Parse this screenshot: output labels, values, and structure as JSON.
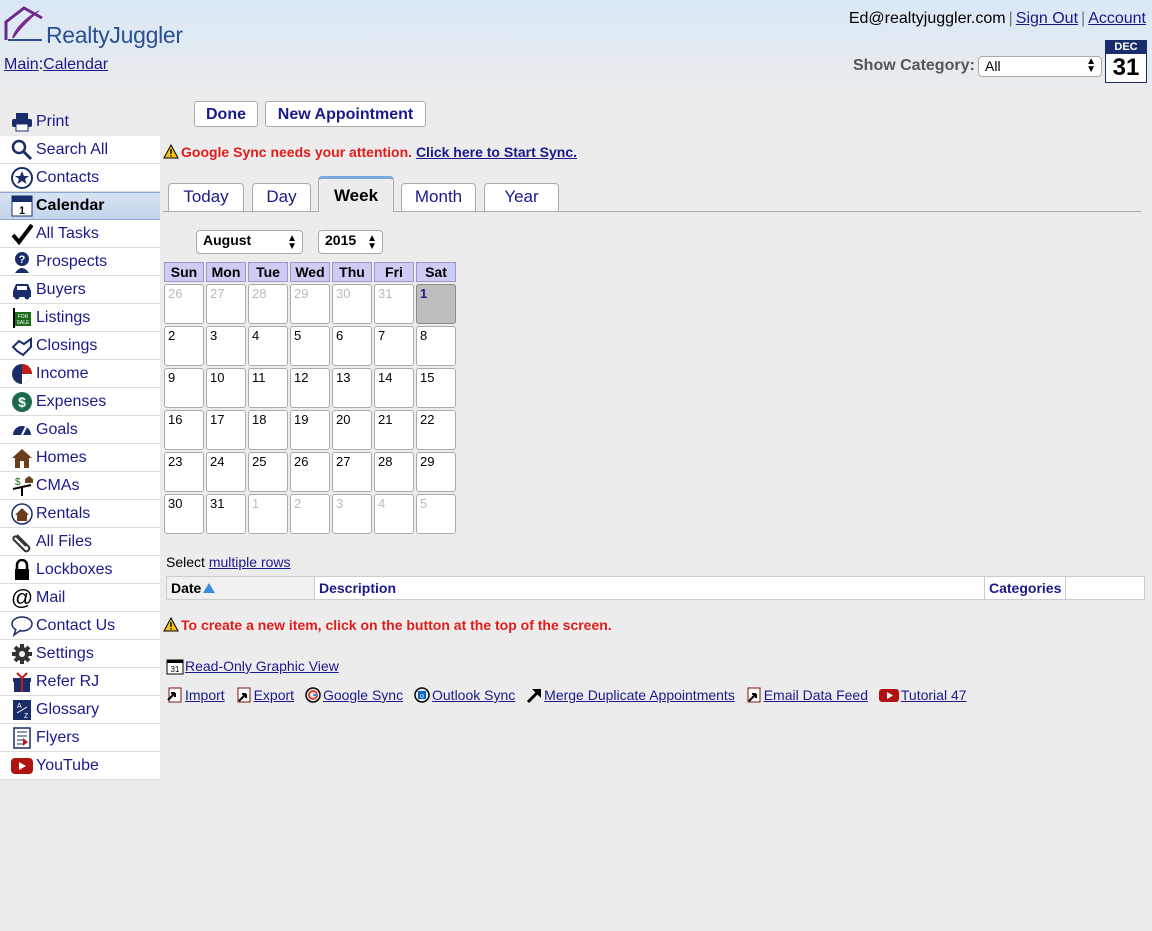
{
  "header": {
    "logo_text": "RealtyJuggler",
    "breadcrumb": {
      "main": "Main",
      "sep": ":",
      "current": "Calendar"
    },
    "user_email": "Ed@realtyjuggler.com",
    "sign_out": "Sign Out",
    "account": "Account",
    "show_category_label": "Show Category:",
    "category_value": "All",
    "cal_icon": {
      "month": "DEC",
      "day": "31"
    }
  },
  "sidebar": {
    "print": "Print",
    "items": [
      {
        "label": "Search All",
        "icon": "search-icon"
      },
      {
        "label": "Contacts",
        "icon": "star-icon"
      },
      {
        "label": "Calendar",
        "icon": "calendar-icon",
        "active": true
      },
      {
        "label": "All Tasks",
        "icon": "checkmark-icon"
      },
      {
        "label": "Prospects",
        "icon": "question-person-icon"
      },
      {
        "label": "Buyers",
        "icon": "car-icon"
      },
      {
        "label": "Listings",
        "icon": "for-sale-sign-icon"
      },
      {
        "label": "Closings",
        "icon": "handshake-icon"
      },
      {
        "label": "Income",
        "icon": "pie-chart-icon"
      },
      {
        "label": "Expenses",
        "icon": "dollar-icon"
      },
      {
        "label": "Goals",
        "icon": "gauge-icon"
      },
      {
        "label": "Homes",
        "icon": "house-icon"
      },
      {
        "label": "CMAs",
        "icon": "scale-icon"
      },
      {
        "label": "Rentals",
        "icon": "rental-house-icon"
      },
      {
        "label": "All Files",
        "icon": "paperclip-icon"
      },
      {
        "label": "Lockboxes",
        "icon": "lock-icon"
      },
      {
        "label": "Mail",
        "icon": "at-icon"
      },
      {
        "label": "Contact Us",
        "icon": "speech-bubble-icon"
      },
      {
        "label": "Settings",
        "icon": "gear-icon"
      },
      {
        "label": "Refer RJ",
        "icon": "gift-icon"
      },
      {
        "label": "Glossary",
        "icon": "glossary-icon"
      },
      {
        "label": "Flyers",
        "icon": "flyer-icon"
      },
      {
        "label": "YouTube",
        "icon": "youtube-icon"
      }
    ]
  },
  "toolbar": {
    "done": "Done",
    "new_appointment": "New Appointment"
  },
  "sync_warning": {
    "text": "Google Sync needs your attention.",
    "link": "Click here to Start Sync."
  },
  "tabs": [
    "Today",
    "Day",
    "Week",
    "Month",
    "Year"
  ],
  "active_tab": "Week",
  "calendar": {
    "month": "August",
    "year": "2015",
    "weekdays": [
      "Sun",
      "Mon",
      "Tue",
      "Wed",
      "Thu",
      "Fri",
      "Sat"
    ],
    "weeks": [
      [
        "26",
        "27",
        "28",
        "29",
        "30",
        "31",
        "1"
      ],
      [
        "2",
        "3",
        "4",
        "5",
        "6",
        "7",
        "8"
      ],
      [
        "9",
        "10",
        "11",
        "12",
        "13",
        "14",
        "15"
      ],
      [
        "16",
        "17",
        "18",
        "19",
        "20",
        "21",
        "22"
      ],
      [
        "23",
        "24",
        "25",
        "26",
        "27",
        "28",
        "29"
      ],
      [
        "30",
        "31",
        "1",
        "2",
        "3",
        "4",
        "5"
      ]
    ],
    "selected_day": "1"
  },
  "select_rows": {
    "prefix": "Select",
    "link": "multiple rows"
  },
  "table": {
    "columns": [
      "Date",
      "Description",
      "Categories"
    ]
  },
  "empty_message": "To create a new item, click on the button at the top of the screen.",
  "links": {
    "graphic_view": "Read-Only Graphic View",
    "import": "Import",
    "export": "Export",
    "google_sync": "Google Sync",
    "outlook_sync": "Outlook Sync",
    "merge": "Merge Duplicate Appointments",
    "email_feed": "Email Data Feed",
    "tutorial": "Tutorial 47"
  },
  "colors": {
    "accent": "#1a1a8c",
    "warning": "#e21b1b",
    "weekday_header": "#ccccf5",
    "tab_active_border": "#7aa7dd"
  }
}
